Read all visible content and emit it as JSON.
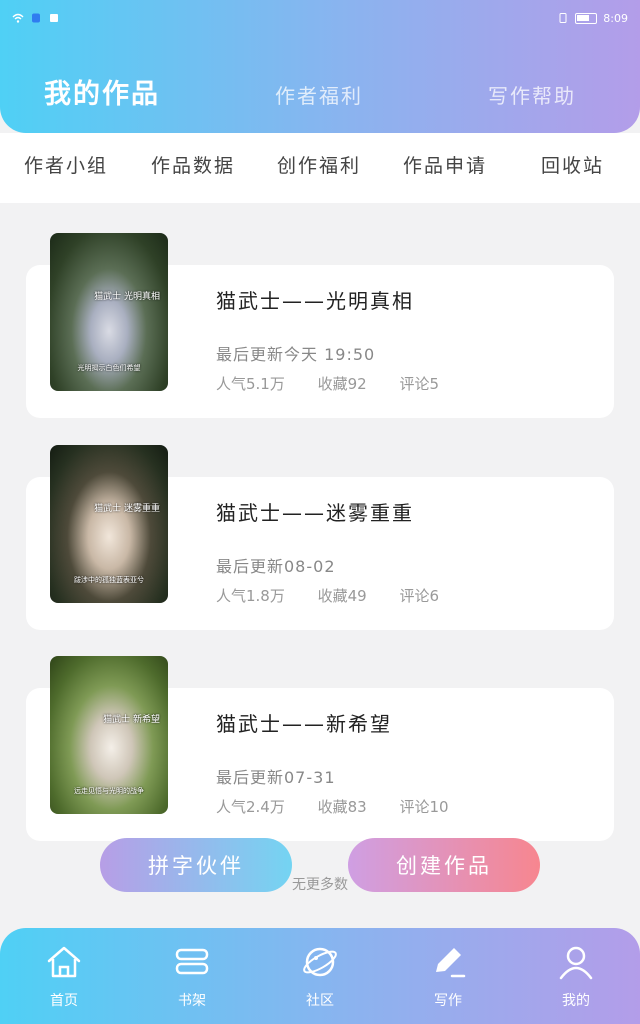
{
  "status_bar": {
    "time": "8:09"
  },
  "header": {
    "tabs": [
      {
        "label": "我的作品"
      },
      {
        "label": "作者福利"
      },
      {
        "label": "写作帮助"
      }
    ]
  },
  "subnav": {
    "items": [
      {
        "label": "作者小组"
      },
      {
        "label": "作品数据"
      },
      {
        "label": "创作福利"
      },
      {
        "label": "作品申请"
      },
      {
        "label": "回收站"
      }
    ]
  },
  "works": [
    {
      "title": "猫武士——光明真相",
      "updated": "最后更新今天 19:50",
      "popularity": "人气5.1万",
      "favorites": "收藏92",
      "comments": "评论5",
      "cover_title": "猫武士 光明真相",
      "cover_caption": "光明揭示白色们希望"
    },
    {
      "title": "猫武士——迷雾重重",
      "updated": "最后更新08-02",
      "popularity": "人气1.8万",
      "favorites": "收藏49",
      "comments": "评论6",
      "cover_title": "猫武士 迷雾重重",
      "cover_caption": "跋涉中的孤独蓝表亚兮"
    },
    {
      "title": "猫武士——新希望",
      "updated": "最后更新07-31",
      "popularity": "人气2.4万",
      "favorites": "收藏83",
      "comments": "评论10",
      "cover_title": "猫武士 新希望",
      "cover_caption": "远走见悟与光明的战争"
    }
  ],
  "footer_note": "无更多数",
  "buttons": {
    "partner": "拼字伙伴",
    "create": "创建作品"
  },
  "bottom_nav": [
    {
      "label": "首页",
      "icon": "home-icon"
    },
    {
      "label": "书架",
      "icon": "bookshelf-icon"
    },
    {
      "label": "社区",
      "icon": "planet-icon"
    },
    {
      "label": "写作",
      "icon": "pen-icon"
    },
    {
      "label": "我的",
      "icon": "user-icon"
    }
  ],
  "colors": {
    "gradient_start": "#4fd0f5",
    "gradient_end": "#b39de9",
    "create_button_end": "#f7868f"
  }
}
